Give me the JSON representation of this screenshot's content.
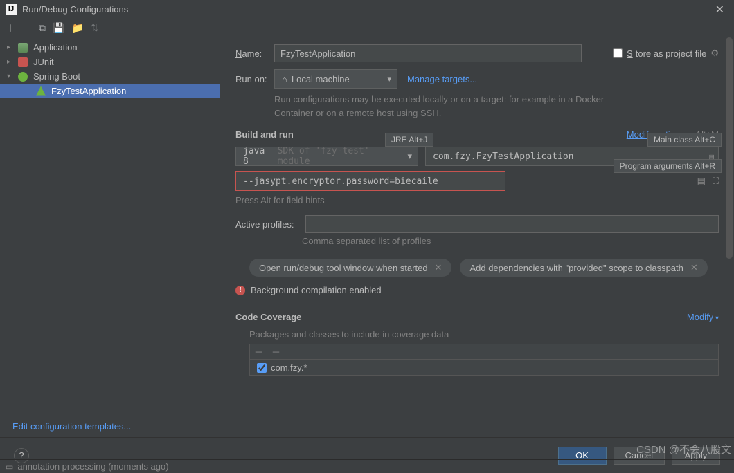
{
  "window": {
    "title": "Run/Debug Configurations"
  },
  "tree": {
    "items": [
      {
        "label": "Application",
        "expanded": false,
        "icon": "app"
      },
      {
        "label": "JUnit",
        "expanded": false,
        "icon": "junit"
      },
      {
        "label": "Spring Boot",
        "expanded": true,
        "icon": "spring"
      },
      {
        "label": "FzyTestApplication",
        "selected": true,
        "icon": "leaf"
      }
    ]
  },
  "sidebar_footer": {
    "edit_templates": "Edit configuration templates..."
  },
  "form": {
    "name_label": "Name:",
    "name_value": "FzyTestApplication",
    "store_label": "Store as project file",
    "runon_label": "Run on:",
    "runon_value": "Local machine",
    "manage_targets": "Manage targets...",
    "runon_desc": "Run configurations may be executed locally or on a target: for example in a Docker Container or on a remote host using SSH."
  },
  "build": {
    "title": "Build and run",
    "modify_label": "Modify options",
    "modify_shortcut": "Alt+M",
    "jre_badge": "JRE Alt+J",
    "mainclass_badge": "Main class Alt+C",
    "args_badge": "Program arguments Alt+R",
    "jre_prefix": "java 8",
    "jre_suffix": "SDK of 'fzy-test' module",
    "main_class": "com.fzy.FzyTestApplication",
    "args_value": "--jasypt.encryptor.password=biecaile",
    "hint": "Press Alt for field hints",
    "profiles_label": "Active profiles:",
    "profiles_value": "",
    "profiles_hint": "Comma separated list of profiles",
    "tag_open_tool": "Open run/debug tool window when started",
    "tag_provided": "Add dependencies with \"provided\" scope to classpath",
    "warn_text": "Background compilation enabled"
  },
  "coverage": {
    "title": "Code Coverage",
    "modify": "Modify",
    "packages_label": "Packages and classes to include in coverage data",
    "item": "com.fzy.*"
  },
  "buttons": {
    "ok": "OK",
    "cancel": "Cancel",
    "apply": "Apply"
  },
  "watermark": "CSDN @不会八股文",
  "status": "annotation processing (moments ago)"
}
